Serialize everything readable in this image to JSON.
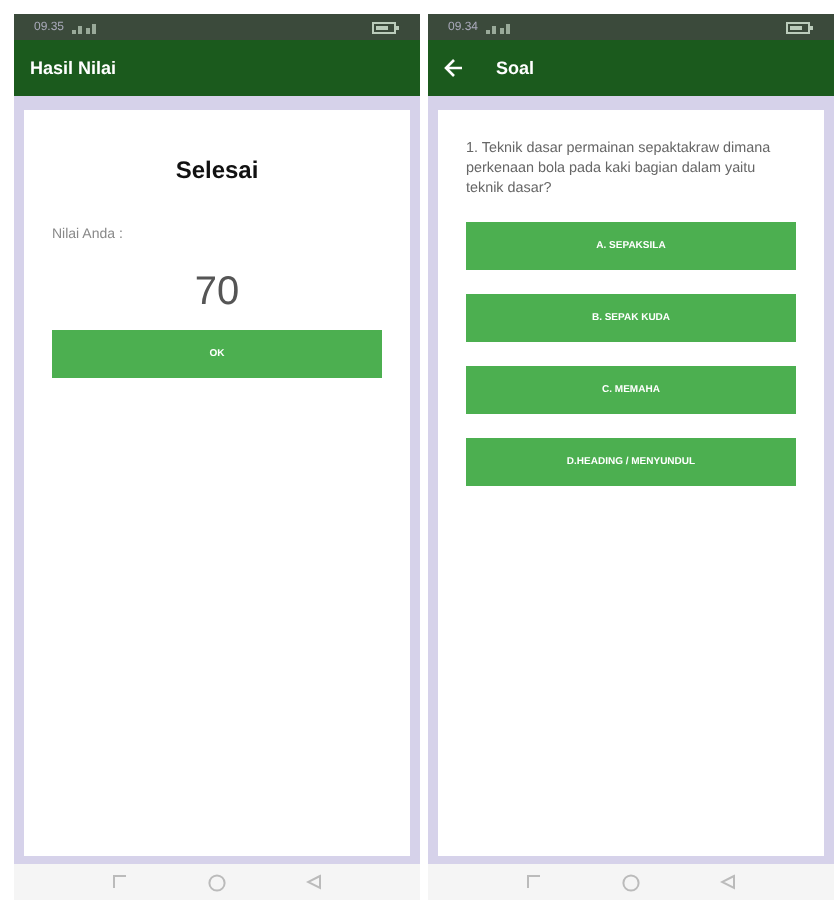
{
  "screens": [
    {
      "kind": "result",
      "status_time": "09.35",
      "title": "Hasil Nilai",
      "back": false,
      "heading": "Selesai",
      "score_label": "Nilai Anda :",
      "score": "70",
      "button": "OK"
    },
    {
      "kind": "quiz",
      "status_time": "09.34",
      "title": "Soal",
      "back": true,
      "question": "1. Teknik dasar permainan sepaktakraw dimana perkenaan bola pada kaki bagian dalam yaitu teknik dasar?",
      "options": [
        "A.   SEPAKSILA",
        "B. SEPAK KUDA",
        "C.   MEMAHA",
        "D.HEADING / MENYUNDUL"
      ]
    }
  ]
}
